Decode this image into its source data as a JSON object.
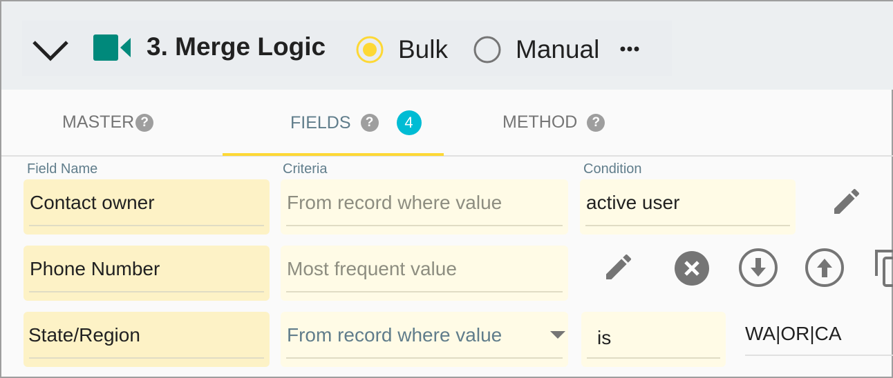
{
  "header": {
    "title": "3. Merge Logic",
    "radio_bulk": "Bulk",
    "radio_manual": "Manual",
    "selected": "Bulk",
    "accent": "#fdd835",
    "icon_color": "#00897b"
  },
  "tabs": [
    {
      "label": "MASTER"
    },
    {
      "label": "FIELDS",
      "badge": "4",
      "active": true
    },
    {
      "label": "METHOD"
    }
  ],
  "columns": {
    "field": "Field Name",
    "criteria": "Criteria",
    "condition": "Condition"
  },
  "rows": [
    {
      "field": "Contact owner",
      "criteria": "From record where value",
      "condition": "active user"
    },
    {
      "field": "Phone Number",
      "criteria": "Most frequent value"
    },
    {
      "field": "State/Region",
      "criteria": "From record where value",
      "operator": "is",
      "value": "WA|OR|CA"
    }
  ]
}
